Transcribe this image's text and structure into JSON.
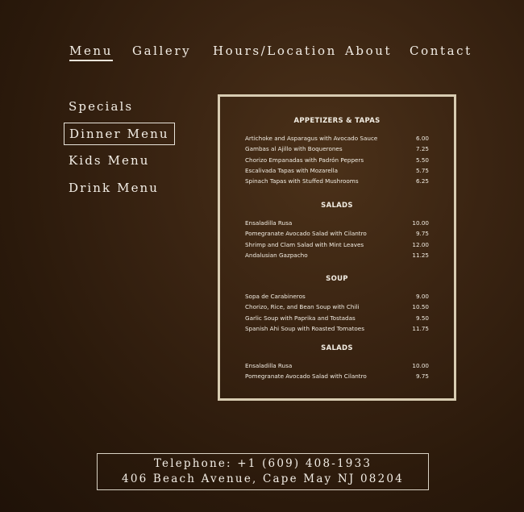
{
  "topnav": {
    "items": [
      {
        "label": "Menu",
        "active": true
      },
      {
        "label": "Gallery",
        "active": false
      },
      {
        "label": "Hours/Location",
        "active": false
      },
      {
        "label": "About",
        "active": false
      },
      {
        "label": "Contact",
        "active": false
      }
    ]
  },
  "sidenav": {
    "items": [
      {
        "label": "Specials",
        "active": false
      },
      {
        "label": "Dinner Menu",
        "active": true
      },
      {
        "label": "Kids Menu",
        "active": false
      },
      {
        "label": "Drink Menu",
        "active": false
      }
    ]
  },
  "menu_card": {
    "sections": [
      {
        "title": "APPETIZERS & TAPAS",
        "items": [
          {
            "name": "Artichoke and Asparagus with Avocado Sauce",
            "price": "6.00"
          },
          {
            "name": "Gambas al Ajillo with Boquerones",
            "price": "7.25"
          },
          {
            "name": "Chorizo Empanadas with Padrón Peppers",
            "price": "5.50"
          },
          {
            "name": "Escalivada Tapas with Mozarella",
            "price": "5.75"
          },
          {
            "name": "Spinach Tapas with Stuffed Mushrooms",
            "price": "6.25"
          }
        ]
      },
      {
        "title": "SALADS",
        "items": [
          {
            "name": "Ensaladilla Rusa",
            "price": "10.00"
          },
          {
            "name": "Pomegranate Avocado Salad with Cilantro",
            "price": "9.75"
          },
          {
            "name": "Shrimp and Clam Salad with Mint Leaves",
            "price": "12.00"
          },
          {
            "name": "Andalusian Gazpacho",
            "price": "11.25"
          }
        ]
      },
      {
        "title": "SOUP",
        "items": [
          {
            "name": "Sopa de Carabineros",
            "price": "9.00"
          },
          {
            "name": "Chorizo, Rice, and Bean Soup with Chili",
            "price": "10.50"
          },
          {
            "name": "Garlic Soup with Paprika and Tostadas",
            "price": "9.50"
          },
          {
            "name": "Spanish Ahi Soup with Roasted Tomatoes",
            "price": "11.75"
          }
        ]
      },
      {
        "title": "SALADS",
        "items": [
          {
            "name": "Ensaladilla Rusa",
            "price": "10.00"
          },
          {
            "name": "Pomegranate Avocado Salad with Cilantro",
            "price": "9.75"
          }
        ]
      }
    ]
  },
  "footer": {
    "telephone": "Telephone: +1 (609) 408-1933",
    "address": "406 Beach Avenue, Cape May NJ 08204"
  },
  "colors": {
    "background": "#2f1d0e",
    "text": "#f3eee6",
    "card_border": "#d8ccb2"
  }
}
